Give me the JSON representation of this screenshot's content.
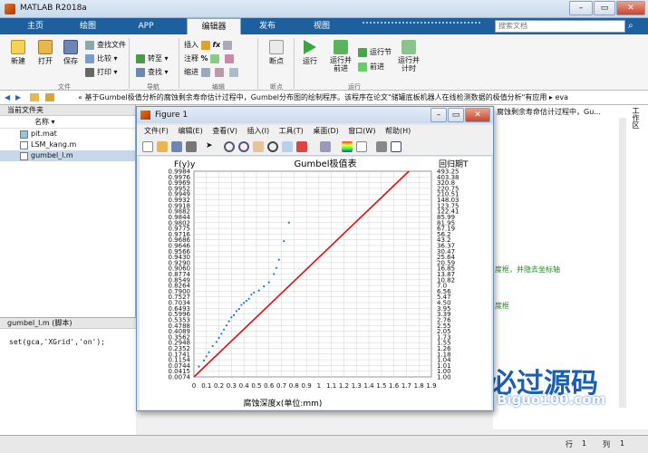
{
  "app": {
    "title": "MATLAB R2018a"
  },
  "tabs": [
    "主页",
    "绘图",
    "APP",
    "编辑器",
    "发布",
    "视图"
  ],
  "search_placeholder": "搜索文档",
  "ribbon": {
    "new": "新建",
    "open": "打开",
    "save": "保存",
    "find_files": "查找文件",
    "compare": "比较",
    "print": "打印",
    "insert": "插入",
    "comment": "注释",
    "indent": "缩进",
    "goto": "转至",
    "find": "查找",
    "breakpoint": "断点",
    "run": "运行",
    "run_advance": "运行并\n前进",
    "run_section": "运行节",
    "advance": "前进",
    "run_time": "运行并\n计时",
    "sections": [
      "文件",
      "导航",
      "编辑",
      "断点",
      "运行"
    ]
  },
  "address": "« 基于Gumbel极值分析的腐蚀剩余寿命估计过程中，Gumbel分布图的绘制程序。该程序在论文\"储罐底板机器人在线检测数据的极值分析\"有应用 ▸ eva",
  "left_panel": {
    "title": "当前文件夹",
    "col_name": "名称",
    "files": [
      "pit.mat",
      "LSM_kang.m",
      "gumbel_l.m"
    ],
    "details_title": "gumbel_l.m  (脚本)",
    "details_code": "set(gca,'XGrid','on');"
  },
  "editor": {
    "header": "腐蚀剩余寿命估计过程中，Gu...",
    "line1": "度框，并隐去坐标轴",
    "line2": "度框",
    "workspace_label": "工作区"
  },
  "status": {
    "row_label": "行",
    "row": "1",
    "col_label": "列",
    "col": "1"
  },
  "figure": {
    "title": "Figure 1",
    "menu": [
      "文件(F)",
      "编辑(E)",
      "查看(V)",
      "插入(I)",
      "工具(T)",
      "桌面(D)",
      "窗口(W)",
      "帮助(H)"
    ]
  },
  "colors": {
    "accent": "#1e5f9e",
    "line": "#e01010",
    "points": "#1f78c8"
  },
  "chart_data": {
    "type": "scatter",
    "title": "Gumbel极值表",
    "xlabel": "腐蚀深度x(单位:mm)",
    "ylabel_left": "F(y)",
    "ylabel_y": "y",
    "ylabel_right": "回归期T",
    "xlim": [
      0,
      1.9
    ],
    "xticks": [
      "0",
      "0.1",
      "0.2",
      "0.3",
      "0.4",
      "0.5",
      "0.6",
      "0.7",
      "0.8",
      "0.9",
      "1",
      "1.1",
      "1.2",
      "1.3",
      "1.4",
      "1.5",
      "1.6",
      "1.7",
      "1.8",
      "1.9"
    ],
    "F_labels": [
      "0.9984",
      "0.9976",
      "0.9969",
      "0.9952",
      "0.9949",
      "0.9932",
      "0.9918",
      "0.9882",
      "0.9844",
      "0.9802",
      "0.9775",
      "0.9716",
      "0.9686",
      "0.9646",
      "0.9566",
      "0.9430",
      "0.9290",
      "0.9060",
      "0.8774",
      "0.8549",
      "0.8264",
      "0.7900",
      "0.7527",
      "0.7034",
      "0.6493",
      "0.5996",
      "0.5353",
      "0.4788",
      "0.4089",
      "0.3562",
      "0.2948",
      "0.2352",
      "0.1741",
      "0.1154",
      "0.0744",
      "0.0415",
      "0.0074"
    ],
    "T_labels": [
      "493.25",
      "403.38",
      "320.8",
      "220.75",
      "210.51",
      "148.03",
      "123.75",
      "122.41",
      "85.99",
      "81.95",
      "67.19",
      "56.2",
      "43.2",
      "36.37",
      "30.47",
      "25.64",
      "20.59",
      "16.85",
      "13.87",
      "10.82",
      "7.0",
      "6.56",
      "5.47",
      "4.50",
      "3.95",
      "3.39",
      "2.76",
      "2.55",
      "2.05",
      "1.73",
      "1.55",
      "1.26",
      "1.18",
      "1.04",
      "1.01",
      "1.00",
      "1.00"
    ],
    "line": {
      "x": [
        0,
        1.72
      ],
      "y": [
        0,
        1
      ]
    },
    "points": {
      "x": [
        0.04,
        0.08,
        0.1,
        0.12,
        0.15,
        0.18,
        0.2,
        0.22,
        0.24,
        0.26,
        0.28,
        0.3,
        0.32,
        0.34,
        0.36,
        0.38,
        0.4,
        0.42,
        0.44,
        0.46,
        0.48,
        0.52,
        0.56,
        0.6,
        0.64,
        0.66,
        0.68,
        0.72,
        0.76
      ],
      "y": [
        0.05,
        0.08,
        0.1,
        0.12,
        0.15,
        0.17,
        0.19,
        0.21,
        0.23,
        0.25,
        0.27,
        0.29,
        0.3,
        0.32,
        0.33,
        0.35,
        0.36,
        0.37,
        0.38,
        0.4,
        0.41,
        0.42,
        0.44,
        0.46,
        0.5,
        0.53,
        0.57,
        0.66,
        0.75
      ]
    }
  }
}
